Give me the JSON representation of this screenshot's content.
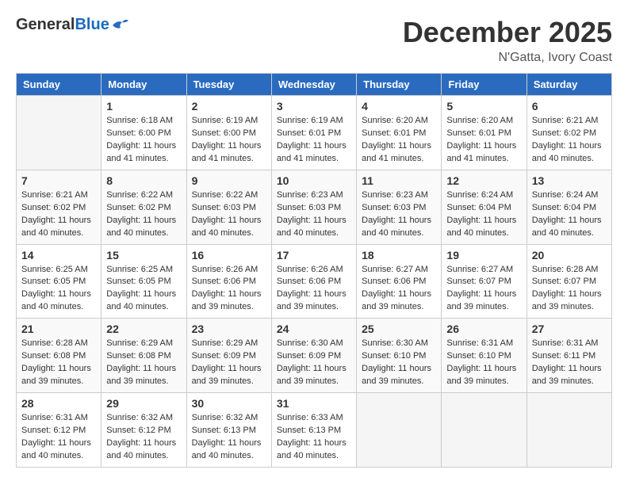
{
  "header": {
    "logo_general": "General",
    "logo_blue": "Blue",
    "month_title": "December 2025",
    "location": "N'Gatta, Ivory Coast"
  },
  "weekdays": [
    "Sunday",
    "Monday",
    "Tuesday",
    "Wednesday",
    "Thursday",
    "Friday",
    "Saturday"
  ],
  "weeks": [
    [
      {
        "day": "",
        "info": ""
      },
      {
        "day": "1",
        "info": "Sunrise: 6:18 AM\nSunset: 6:00 PM\nDaylight: 11 hours\nand 41 minutes."
      },
      {
        "day": "2",
        "info": "Sunrise: 6:19 AM\nSunset: 6:00 PM\nDaylight: 11 hours\nand 41 minutes."
      },
      {
        "day": "3",
        "info": "Sunrise: 6:19 AM\nSunset: 6:01 PM\nDaylight: 11 hours\nand 41 minutes."
      },
      {
        "day": "4",
        "info": "Sunrise: 6:20 AM\nSunset: 6:01 PM\nDaylight: 11 hours\nand 41 minutes."
      },
      {
        "day": "5",
        "info": "Sunrise: 6:20 AM\nSunset: 6:01 PM\nDaylight: 11 hours\nand 41 minutes."
      },
      {
        "day": "6",
        "info": "Sunrise: 6:21 AM\nSunset: 6:02 PM\nDaylight: 11 hours\nand 40 minutes."
      }
    ],
    [
      {
        "day": "7",
        "info": "Sunrise: 6:21 AM\nSunset: 6:02 PM\nDaylight: 11 hours\nand 40 minutes."
      },
      {
        "day": "8",
        "info": "Sunrise: 6:22 AM\nSunset: 6:02 PM\nDaylight: 11 hours\nand 40 minutes."
      },
      {
        "day": "9",
        "info": "Sunrise: 6:22 AM\nSunset: 6:03 PM\nDaylight: 11 hours\nand 40 minutes."
      },
      {
        "day": "10",
        "info": "Sunrise: 6:23 AM\nSunset: 6:03 PM\nDaylight: 11 hours\nand 40 minutes."
      },
      {
        "day": "11",
        "info": "Sunrise: 6:23 AM\nSunset: 6:03 PM\nDaylight: 11 hours\nand 40 minutes."
      },
      {
        "day": "12",
        "info": "Sunrise: 6:24 AM\nSunset: 6:04 PM\nDaylight: 11 hours\nand 40 minutes."
      },
      {
        "day": "13",
        "info": "Sunrise: 6:24 AM\nSunset: 6:04 PM\nDaylight: 11 hours\nand 40 minutes."
      }
    ],
    [
      {
        "day": "14",
        "info": "Sunrise: 6:25 AM\nSunset: 6:05 PM\nDaylight: 11 hours\nand 40 minutes."
      },
      {
        "day": "15",
        "info": "Sunrise: 6:25 AM\nSunset: 6:05 PM\nDaylight: 11 hours\nand 40 minutes."
      },
      {
        "day": "16",
        "info": "Sunrise: 6:26 AM\nSunset: 6:06 PM\nDaylight: 11 hours\nand 39 minutes."
      },
      {
        "day": "17",
        "info": "Sunrise: 6:26 AM\nSunset: 6:06 PM\nDaylight: 11 hours\nand 39 minutes."
      },
      {
        "day": "18",
        "info": "Sunrise: 6:27 AM\nSunset: 6:06 PM\nDaylight: 11 hours\nand 39 minutes."
      },
      {
        "day": "19",
        "info": "Sunrise: 6:27 AM\nSunset: 6:07 PM\nDaylight: 11 hours\nand 39 minutes."
      },
      {
        "day": "20",
        "info": "Sunrise: 6:28 AM\nSunset: 6:07 PM\nDaylight: 11 hours\nand 39 minutes."
      }
    ],
    [
      {
        "day": "21",
        "info": "Sunrise: 6:28 AM\nSunset: 6:08 PM\nDaylight: 11 hours\nand 39 minutes."
      },
      {
        "day": "22",
        "info": "Sunrise: 6:29 AM\nSunset: 6:08 PM\nDaylight: 11 hours\nand 39 minutes."
      },
      {
        "day": "23",
        "info": "Sunrise: 6:29 AM\nSunset: 6:09 PM\nDaylight: 11 hours\nand 39 minutes."
      },
      {
        "day": "24",
        "info": "Sunrise: 6:30 AM\nSunset: 6:09 PM\nDaylight: 11 hours\nand 39 minutes."
      },
      {
        "day": "25",
        "info": "Sunrise: 6:30 AM\nSunset: 6:10 PM\nDaylight: 11 hours\nand 39 minutes."
      },
      {
        "day": "26",
        "info": "Sunrise: 6:31 AM\nSunset: 6:10 PM\nDaylight: 11 hours\nand 39 minutes."
      },
      {
        "day": "27",
        "info": "Sunrise: 6:31 AM\nSunset: 6:11 PM\nDaylight: 11 hours\nand 39 minutes."
      }
    ],
    [
      {
        "day": "28",
        "info": "Sunrise: 6:31 AM\nSunset: 6:12 PM\nDaylight: 11 hours\nand 40 minutes."
      },
      {
        "day": "29",
        "info": "Sunrise: 6:32 AM\nSunset: 6:12 PM\nDaylight: 11 hours\nand 40 minutes."
      },
      {
        "day": "30",
        "info": "Sunrise: 6:32 AM\nSunset: 6:13 PM\nDaylight: 11 hours\nand 40 minutes."
      },
      {
        "day": "31",
        "info": "Sunrise: 6:33 AM\nSunset: 6:13 PM\nDaylight: 11 hours\nand 40 minutes."
      },
      {
        "day": "",
        "info": ""
      },
      {
        "day": "",
        "info": ""
      },
      {
        "day": "",
        "info": ""
      }
    ]
  ]
}
